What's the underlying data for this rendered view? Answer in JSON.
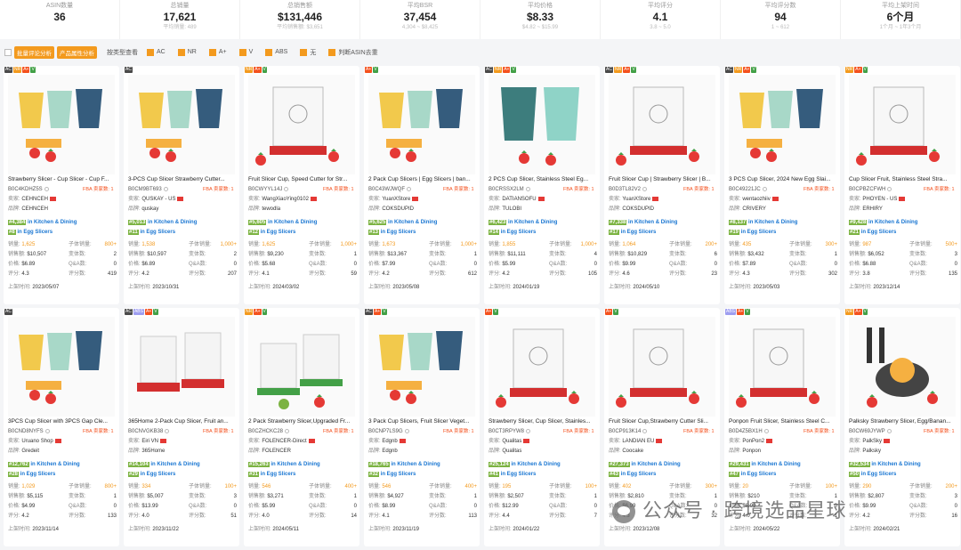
{
  "stats": [
    {
      "label": "ASIN数量",
      "value": "36",
      "sub": ""
    },
    {
      "label": "总销量",
      "value": "17,621",
      "sub": "平均销量: 489"
    },
    {
      "label": "总销售额",
      "value": "$131,446",
      "sub": "平均销售额: $3,651"
    },
    {
      "label": "平均BSR",
      "value": "37,454",
      "sub": "4,304 ~ $8,425"
    },
    {
      "label": "平均价格",
      "value": "$8.33",
      "sub": "$4.82 ~ $15.99"
    },
    {
      "label": "平均评分",
      "value": "4.1",
      "sub": "3.8 ~ 5.0"
    },
    {
      "label": "平均评分数",
      "value": "94",
      "sub": "1 ~ 612"
    },
    {
      "label": "平均上架时间",
      "value": "6个月",
      "sub": "1个月 ~ 1年3个月"
    }
  ],
  "toolbar": {
    "btn_review": "批量评论分析",
    "btn_attr": "产品属性分析",
    "view_label": "按类型查看",
    "filters": [
      {
        "label": "AC",
        "checked": true
      },
      {
        "label": "NR",
        "checked": true
      },
      {
        "label": "A+",
        "checked": true
      },
      {
        "label": "V",
        "checked": true
      },
      {
        "label": "ABS",
        "checked": true
      },
      {
        "label": "无",
        "checked": true
      },
      {
        "label": "判断ASIN去重",
        "checked": true
      }
    ]
  },
  "labels": {
    "seller": "卖家:",
    "brand": "品牌:",
    "sales": "销量:",
    "child_sales": "子体销量:",
    "revenue": "销售额:",
    "variants": "变体数:",
    "price": "价格:",
    "qa": "Q&A数:",
    "rating": "评分:",
    "reviews": "评分数:",
    "listed": "上架时间:",
    "fba": "FBA",
    "sellers": "卖家数: 1"
  },
  "products": [
    {
      "badges": [
        "AC",
        "NR",
        "A+",
        "V"
      ],
      "title": "Strawberry Slicer - Cup Slicer - Cup F...",
      "asin": "B0C4KDHZ5S",
      "seller": "CEHNCEH",
      "brand": "CEHNCEH",
      "rank1": "#4,384",
      "cat1": "in Kitchen & Dining",
      "rank2": "#8",
      "cat2": "in Egg Slicers",
      "sales": "1,625",
      "child": "800+",
      "revenue": "$10,507",
      "variants": "2",
      "price": "$6.89",
      "qa": "0",
      "rating": "4.3",
      "reviews": "419",
      "date": "2023/05/07",
      "img": "cups3"
    },
    {
      "badges": [
        "AC"
      ],
      "title": "3-PCS Cup Slicer Strawberry Cutter...",
      "asin": "B0CM9BT693",
      "seller": "QUSKAY - US",
      "brand": "quskay",
      "rank1": "#5,013",
      "cat1": "in Kitchen & Dining",
      "rank2": "#11",
      "cat2": "in Egg Slicers",
      "sales": "1,538",
      "child": "1,000+",
      "revenue": "$10,597",
      "variants": "2",
      "price": "$6.89",
      "qa": "0",
      "rating": "4.2",
      "reviews": "207",
      "date": "2023/10/31",
      "img": "cups3"
    },
    {
      "badges": [
        "NR",
        "A+",
        "V"
      ],
      "title": "Fruit Slicer Cup, Speed Cutter for Str...",
      "asin": "B0CWYYL14J",
      "seller": "WangXiaoYing0102",
      "brand": "tewodla",
      "rank1": "#5,605",
      "cat1": "in Kitchen & Dining",
      "rank2": "#12",
      "cat2": "in Egg Slicers",
      "sales": "1,625",
      "child": "1,000+",
      "revenue": "$9,230",
      "variants": "1",
      "price": "$5.68",
      "qa": "0",
      "rating": "4.1",
      "reviews": "59",
      "date": "2024/03/02",
      "img": "clear"
    },
    {
      "badges": [
        "A+",
        "V"
      ],
      "title": "2 Pack Cup Slicers | Egg Slicers | ban...",
      "asin": "B0C43WJWQF",
      "seller": "YuanXStore",
      "brand": "COKSDUPID",
      "rank1": "#5,625",
      "cat1": "in Kitchen & Dining",
      "rank2": "#13",
      "cat2": "in Egg Slicers",
      "sales": "1,673",
      "child": "1,000+",
      "revenue": "$13,367",
      "variants": "1",
      "price": "$7.99",
      "qa": "0",
      "rating": "4.2",
      "reviews": "612",
      "date": "2023/05/08",
      "img": "cups3"
    },
    {
      "badges": [
        "AC",
        "NR",
        "A+",
        "V"
      ],
      "title": "2 PCS Cup Slicer, Stainless Steel Eg...",
      "asin": "B0CRSSX2LM",
      "seller": "DATIANSOFU",
      "brand": "TULOBI",
      "rank1": "#6,423",
      "cat1": "in Kitchen & Dining",
      "rank2": "#14",
      "cat2": "in Egg Slicers",
      "sales": "1,855",
      "child": "1,000+",
      "revenue": "$11,111",
      "variants": "4",
      "price": "$5.99",
      "qa": "0",
      "rating": "4.2",
      "reviews": "105",
      "date": "2024/01/19",
      "img": "cups2"
    },
    {
      "badges": [
        "AC",
        "NR",
        "A+",
        "V"
      ],
      "title": "Fruit Slicer Cup | Strawberry Slicer | B...",
      "asin": "B0D3TL82V2",
      "seller": "YuanXStore",
      "brand": "COKSDUPID",
      "rank1": "#7,338",
      "cat1": "in Kitchen & Dining",
      "rank2": "#17",
      "cat2": "in Egg Slicers",
      "sales": "1,064",
      "child": "200+",
      "revenue": "$10,829",
      "variants": "6",
      "price": "$9.99",
      "qa": "0",
      "rating": "4.6",
      "reviews": "23",
      "date": "2024/05/10",
      "img": "clear"
    },
    {
      "badges": [
        "AC",
        "NR",
        "A+",
        "V"
      ],
      "title": "3 PCS Cup Slicer, 2024 New Egg Slai...",
      "asin": "B0C49221JC",
      "seller": "wentaozhiiv",
      "brand": "CRIVERY",
      "rank1": "#8,137",
      "cat1": "in Kitchen & Dining",
      "rank2": "#19",
      "cat2": "in Egg Slicers",
      "sales": "435",
      "child": "300+",
      "revenue": "$3,432",
      "variants": "1",
      "price": "$7.89",
      "qa": "0",
      "rating": "4.3",
      "reviews": "302",
      "date": "2023/05/03",
      "img": "cups3"
    },
    {
      "badges": [
        "NR",
        "A+",
        "V"
      ],
      "title": "Cup Slicer Fruit, Stainless Steel Stra...",
      "asin": "B0CPBZCFWH",
      "seller": "PHOYEN - US",
      "brand": "ERHIRY",
      "rank1": "#9,428",
      "cat1": "in Kitchen & Dining",
      "rank2": "#21",
      "cat2": "in Egg Slicers",
      "sales": "987",
      "child": "500+",
      "revenue": "$6,052",
      "variants": "3",
      "price": "$6.88",
      "qa": "0",
      "rating": "3.8",
      "reviews": "135",
      "date": "2023/12/14",
      "img": "clear"
    },
    {
      "badges": [
        "AC"
      ],
      "title": "3PCS Cup Slicer with 3PCS Gap Cle...",
      "asin": "B0CND8NYFS",
      "seller": "Uruano Shop",
      "brand": "Gredeit",
      "rank1": "#12,762",
      "cat1": "in Kitchen & Dining",
      "rank2": "#28",
      "cat2": "in Egg Slicers",
      "sales": "1,029",
      "child": "800+",
      "revenue": "$5,115",
      "variants": "1",
      "price": "$4.99",
      "qa": "0",
      "rating": "4.2",
      "reviews": "133",
      "date": "2023/11/14",
      "img": "cups3"
    },
    {
      "badges": [
        "AC",
        "ABS",
        "A+",
        "V"
      ],
      "title": "365Home 2-Pack Cup Slicer, Fruit an...",
      "asin": "B0CNVGKB38",
      "seller": "Eiri VN",
      "brand": "365Home",
      "rank1": "#14,104",
      "cat1": "in Kitchen & Dining",
      "rank2": "#29",
      "cat2": "in Egg Slicers",
      "sales": "334",
      "child": "100+",
      "revenue": "$5,007",
      "variants": "3",
      "price": "$13.99",
      "qa": "0",
      "rating": "4.0",
      "reviews": "51",
      "date": "2023/11/22",
      "img": "red2"
    },
    {
      "badges": [
        "NR",
        "A+",
        "V"
      ],
      "title": "2 Pack Strawberry Slicer,Upgraded Fr...",
      "asin": "B0CZHCKC28",
      "seller": "FOLENCER-Direct",
      "brand": "FOLENCER",
      "rank1": "#15,263",
      "cat1": "in Kitchen & Dining",
      "rank2": "#31",
      "cat2": "in Egg Slicers",
      "sales": "546",
      "child": "400+",
      "revenue": "$3,271",
      "variants": "1",
      "price": "$5.99",
      "qa": "0",
      "rating": "4.0",
      "reviews": "14",
      "date": "2024/05/11",
      "img": "green2"
    },
    {
      "badges": [
        "AC",
        "A+",
        "V"
      ],
      "title": "3 Pack Cup Slicers, Fruit Slicer Veget...",
      "asin": "B0CNP7LS9G",
      "seller": "Edgnb",
      "brand": "Edgnb",
      "rank1": "#18,765",
      "cat1": "in Kitchen & Dining",
      "rank2": "#32",
      "cat2": "in Egg Slicers",
      "sales": "546",
      "child": "400+",
      "revenue": "$4,927",
      "variants": "1",
      "price": "$8.99",
      "qa": "0",
      "rating": "4.1",
      "reviews": "113",
      "date": "2023/11/19",
      "img": "cups3"
    },
    {
      "badges": [
        "A+",
        "V"
      ],
      "title": "Strawberry Slicer, Cup Slicer, Stainles...",
      "asin": "B0CT3RPYW8",
      "seller": "Qualitas",
      "brand": "Qualitas",
      "rank1": "#25,124",
      "cat1": "in Kitchen & Dining",
      "rank2": "#41",
      "cat2": "in Egg Slicers",
      "sales": "195",
      "child": "100+",
      "revenue": "$2,507",
      "variants": "1",
      "price": "$12.99",
      "qa": "0",
      "rating": "4.4",
      "reviews": "7",
      "date": "2024/01/22",
      "img": "clear"
    },
    {
      "badges": [
        "A+",
        "V"
      ],
      "title": "Fruit Slicer Cup,Strawberry Cutter Sli...",
      "asin": "B0CP913K14",
      "seller": "LANDIAN EU",
      "brand": "Coocake",
      "rank1": "#27,373",
      "cat1": "in Kitchen & Dining",
      "rank2": "#43",
      "cat2": "in Egg Slicers",
      "sales": "402",
      "child": "300+",
      "revenue": "$2,810",
      "variants": "1",
      "price": "$6.99",
      "qa": "0",
      "rating": "4.3",
      "reviews": "32",
      "date": "2023/12/08",
      "img": "clear"
    },
    {
      "badges": [
        "ABS",
        "A+",
        "V"
      ],
      "title": "Ponpon Fruit Slicer, Stainless Steel C...",
      "asin": "B0D4Z5BX1H",
      "seller": "PonPon2",
      "brand": "Ponpon",
      "rank1": "#29,431",
      "cat1": "in Kitchen & Dining",
      "rank2": "#47",
      "cat2": "in Egg Slicers",
      "sales": "20",
      "child": "100+",
      "revenue": "$210",
      "variants": "1",
      "price": "$8.99",
      "qa": "0",
      "rating": "4.0",
      "reviews": "1",
      "date": "2024/05/22",
      "img": "clear"
    },
    {
      "badges": [
        "NR",
        "A+",
        "V"
      ],
      "title": "Palksky Strawberry Slicer, Egg/Banan...",
      "asin": "B0CW69JYWP",
      "seller": "PalkSky",
      "brand": "Palksky",
      "rank1": "#32,534",
      "cat1": "in Kitchen & Dining",
      "rank2": "#50",
      "cat2": "in Egg Slicers",
      "sales": "290",
      "child": "200+",
      "revenue": "$2,807",
      "variants": "3",
      "price": "$9.99",
      "qa": "0",
      "rating": "4.2",
      "reviews": "16",
      "date": "2024/02/21",
      "img": "dark"
    }
  ],
  "watermark": "公众号 · 跨境选品星球"
}
